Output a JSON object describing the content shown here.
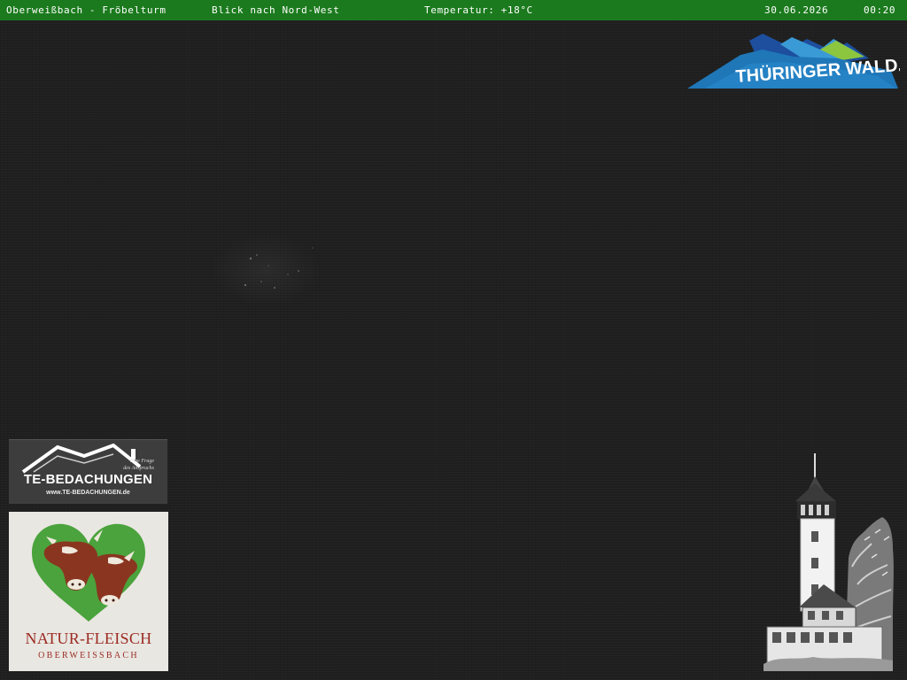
{
  "status_bar": {
    "location": "Oberweißbach - Fröbelturm",
    "view": "Blick nach Nord-West",
    "temperature": "Temperatur: +18°C",
    "date": "30.06.2026",
    "time": "00:20"
  },
  "logos": {
    "thueringer_wald": "THÜRINGER WALD.",
    "te_bedachungen": {
      "name": "TE-BEDACHUNGEN",
      "tagline_1": "Eine Frage",
      "tagline_2": "des Anspruchs",
      "url": "www.TE-BEDACHUNGEN.de"
    },
    "natur_fleisch": {
      "name": "NATUR-FLEISCH",
      "place": "OBERWEISSBACH"
    }
  },
  "colors": {
    "status_bar_bg": "#1b7a1d",
    "sky": "#1f1f1f",
    "heart_green": "#4aa33c",
    "cow_brown": "#8a3520",
    "logo_blue": "#1f77b8"
  }
}
